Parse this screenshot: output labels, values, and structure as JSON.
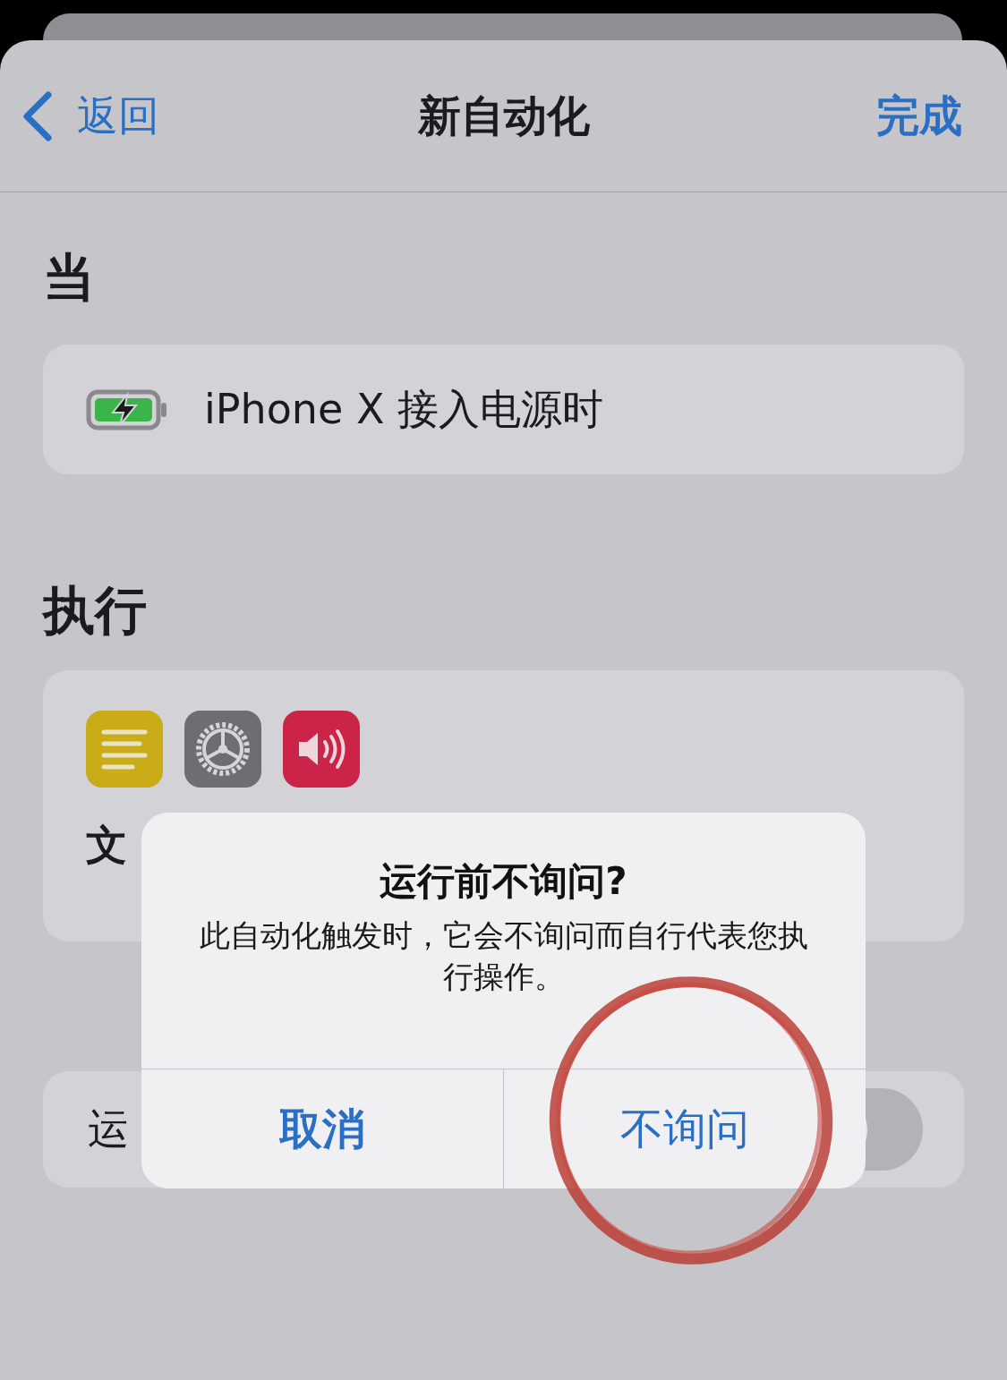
{
  "nav": {
    "back": "返回",
    "title": "新自动化",
    "done": "完成"
  },
  "when": {
    "heading": "当",
    "trigger": "iPhone X 接入电源时"
  },
  "do": {
    "heading": "执行",
    "actions": [
      {
        "kind": "text"
      },
      {
        "kind": "settings"
      },
      {
        "kind": "sound"
      }
    ],
    "label": "文"
  },
  "ask_row": {
    "label": "运",
    "on": false
  },
  "alert": {
    "title": "运行前不询问?",
    "message": "此自动化触发时，它会不询问而自行代表您执行操作。",
    "buttons": [
      {
        "label": "取消",
        "bold": true
      },
      {
        "label": "不询问",
        "bold": false
      }
    ]
  }
}
